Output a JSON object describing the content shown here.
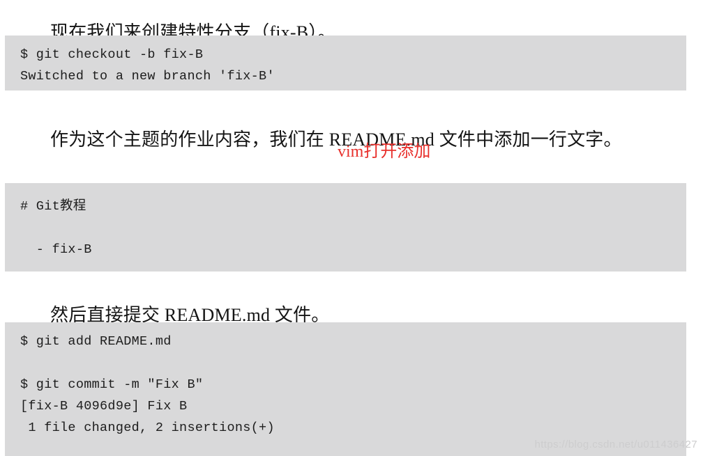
{
  "document": {
    "background_color": "#ffffff",
    "code_block_color": "#d9d9da",
    "annotation_color": "#e8302c",
    "watermark_color": "#cdcdce"
  },
  "paragraphs": {
    "p1": "现在我们来创建特性分支（fix-B）。",
    "p2": "作为这个主题的作业内容，我们在 README.md 文件中添加一行文字。",
    "p3": "然后直接提交 README.md 文件。"
  },
  "annotation": {
    "text": "vim打开添加"
  },
  "code_blocks": [
    {
      "id": "checkout-block",
      "lines": [
        "$ git checkout -b fix-B",
        "Switched to a new branch 'fix-B'"
      ]
    },
    {
      "id": "readme-content-block",
      "lines": [
        "# Git教程",
        "",
        "  - fix-B"
      ]
    },
    {
      "id": "commit-block",
      "lines": [
        "$ git add README.md",
        "",
        "$ git commit -m \"Fix B\"",
        "[fix-B 4096d9e] Fix B",
        " 1 file changed, 2 insertions(+)"
      ]
    }
  ],
  "watermark": {
    "text": "https://blog.csdn.net/u011436427"
  }
}
